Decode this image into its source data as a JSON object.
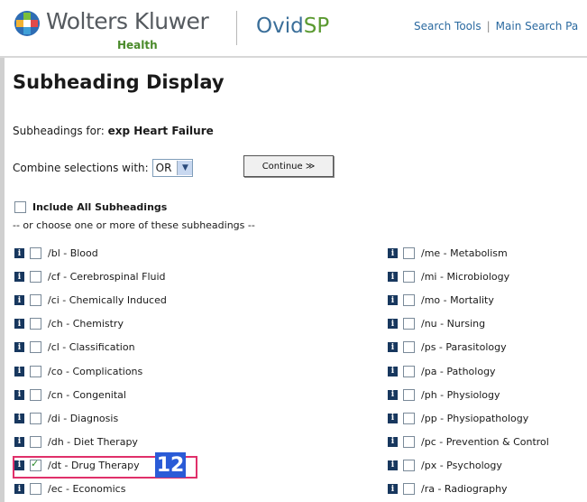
{
  "header": {
    "brand": "Wolters Kluwer",
    "brand_sub": "Health",
    "product": "Ovid",
    "product_suffix": "SP",
    "links": [
      "Search Tools",
      "Main Search Pa"
    ]
  },
  "page_title": "Subheading Display",
  "subheadings_for_label": "Subheadings for: ",
  "subheadings_for_term": "exp Heart Failure",
  "combine_label": "Combine selections with:",
  "combine_value": "OR",
  "continue_label": "Continue ≫",
  "include_all_label": "Include All Subheadings",
  "choose_text": "-- or choose one or more of these subheadings --",
  "left_column": [
    {
      "label": "/bl - Blood",
      "checked": false
    },
    {
      "label": "/cf - Cerebrospinal Fluid",
      "checked": false
    },
    {
      "label": "/ci - Chemically Induced",
      "checked": false
    },
    {
      "label": "/ch - Chemistry",
      "checked": false
    },
    {
      "label": "/cl - Classification",
      "checked": false
    },
    {
      "label": "/co - Complications",
      "checked": false
    },
    {
      "label": "/cn - Congenital",
      "checked": false
    },
    {
      "label": "/di - Diagnosis",
      "checked": false
    },
    {
      "label": "/dh - Diet Therapy",
      "checked": false
    },
    {
      "label": "/dt - Drug Therapy",
      "checked": true
    },
    {
      "label": "/ec - Economics",
      "checked": false
    }
  ],
  "right_column": [
    {
      "label": "/me - Metabolism",
      "checked": false
    },
    {
      "label": "/mi - Microbiology",
      "checked": false
    },
    {
      "label": "/mo - Mortality",
      "checked": false
    },
    {
      "label": "/nu - Nursing",
      "checked": false
    },
    {
      "label": "/ps - Parasitology",
      "checked": false
    },
    {
      "label": "/pa - Pathology",
      "checked": false
    },
    {
      "label": "/ph - Physiology",
      "checked": false
    },
    {
      "label": "/pp - Physiopathology",
      "checked": false
    },
    {
      "label": "/pc - Prevention & Control",
      "checked": false
    },
    {
      "label": "/px - Psychology",
      "checked": false
    },
    {
      "label": "/ra - Radiography",
      "checked": false
    }
  ],
  "annotation_badge": "12",
  "info_icon_glyph": "i",
  "colors": {
    "link": "#2b6aa0",
    "info_icon": "#17375e",
    "highlight": "#e0306a",
    "badge": "#2a5bd7"
  }
}
